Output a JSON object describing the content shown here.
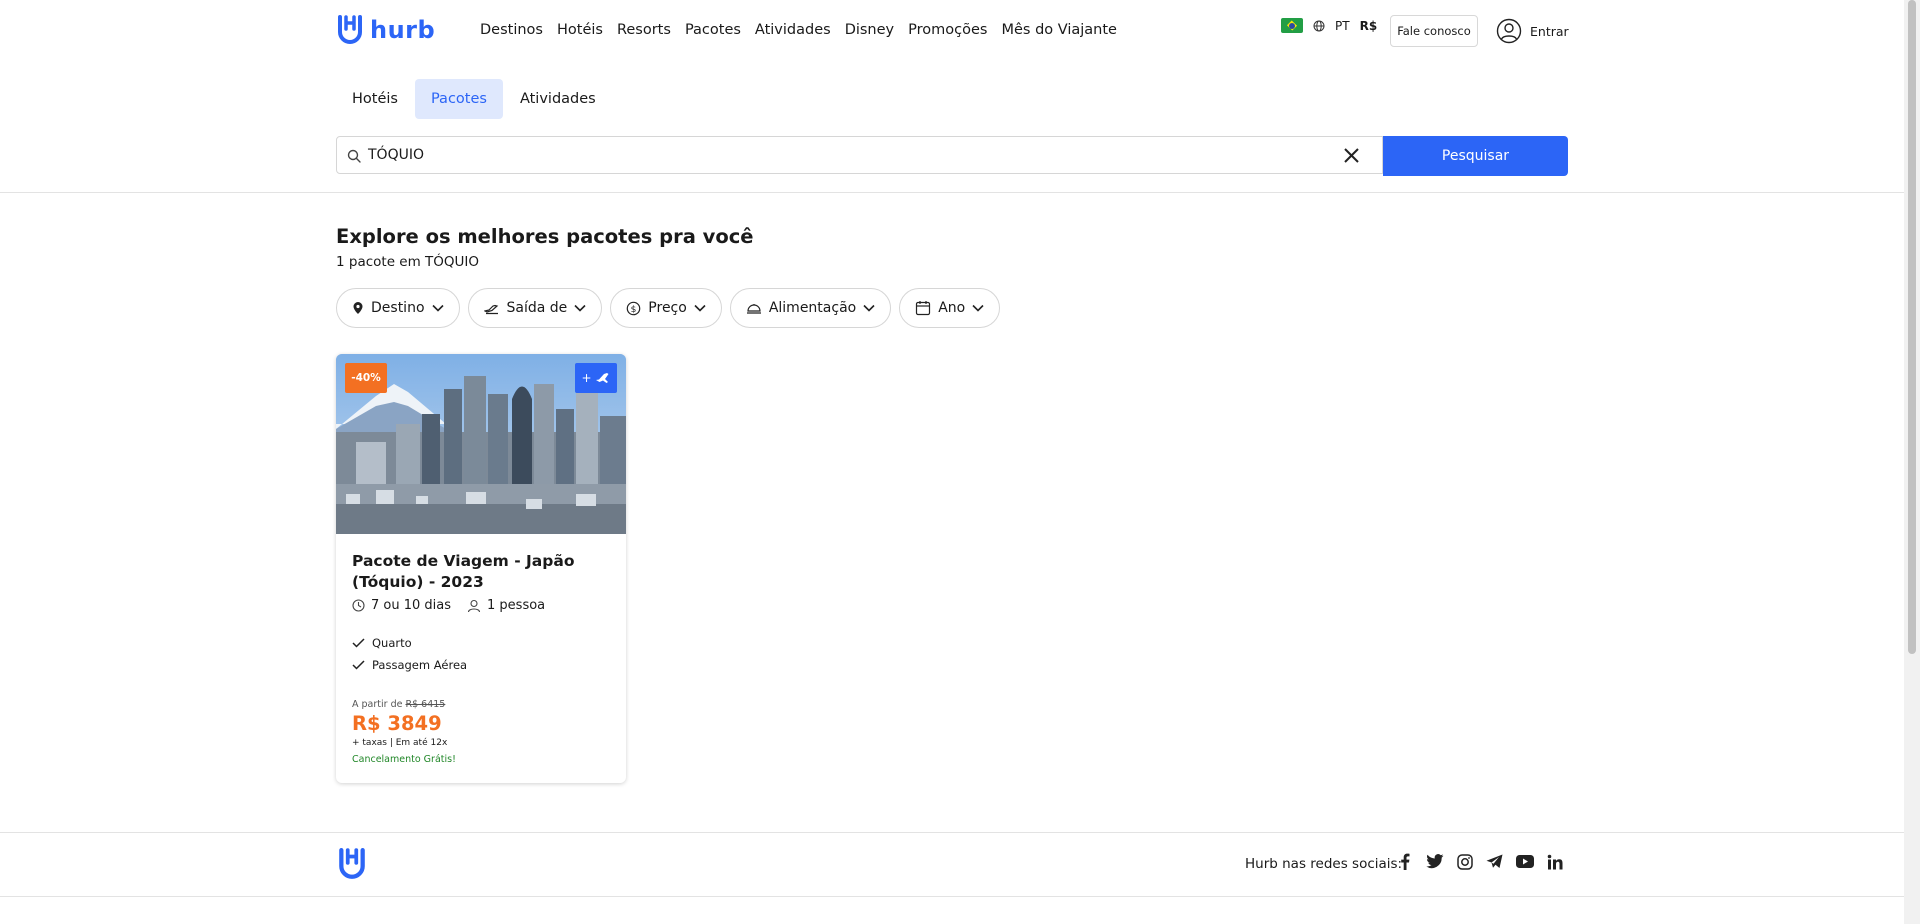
{
  "brand": {
    "name": "hurb",
    "color": "#2c65f6"
  },
  "nav": {
    "items": [
      "Destinos",
      "Hotéis",
      "Resorts",
      "Pacotes",
      "Atividades",
      "Disney",
      "Promoções",
      "Mês do Viajante"
    ]
  },
  "locale": {
    "language": "PT",
    "currency": "R$"
  },
  "header": {
    "contact_label": "Fale conosco",
    "login_label": "Entrar"
  },
  "tabs": [
    {
      "label": "Hotéis",
      "active": false
    },
    {
      "label": "Pacotes",
      "active": true
    },
    {
      "label": "Atividades",
      "active": false
    }
  ],
  "search": {
    "value": "TÓQUIO",
    "button_label": "Pesquisar"
  },
  "results": {
    "title": "Explore os melhores pacotes pra você",
    "subtitle": "1 pacote em TÓQUIO"
  },
  "filters": [
    "Destino",
    "Saída de",
    "Preço",
    "Alimentação",
    "Ano"
  ],
  "card": {
    "discount": "-40%",
    "air_badge": "+",
    "title": "Pacote de Viagem - Japão (Tóquio) - 2023",
    "duration": "7 ou 10 dias",
    "people": "1 pessoa",
    "includes": [
      "Quarto",
      "Passagem Aérea"
    ],
    "from_label": "A partir de",
    "old_price": "R$ 6415",
    "price": "R$ 3849",
    "taxes": "+ taxas | Em até 12x",
    "cancel": "Cancelamento Grátis!"
  },
  "footer": {
    "social_label": "Hurb nas redes sociais:",
    "socials": [
      "facebook-icon",
      "twitter-icon",
      "instagram-icon",
      "telegram-icon",
      "youtube-icon",
      "linkedin-icon"
    ]
  }
}
